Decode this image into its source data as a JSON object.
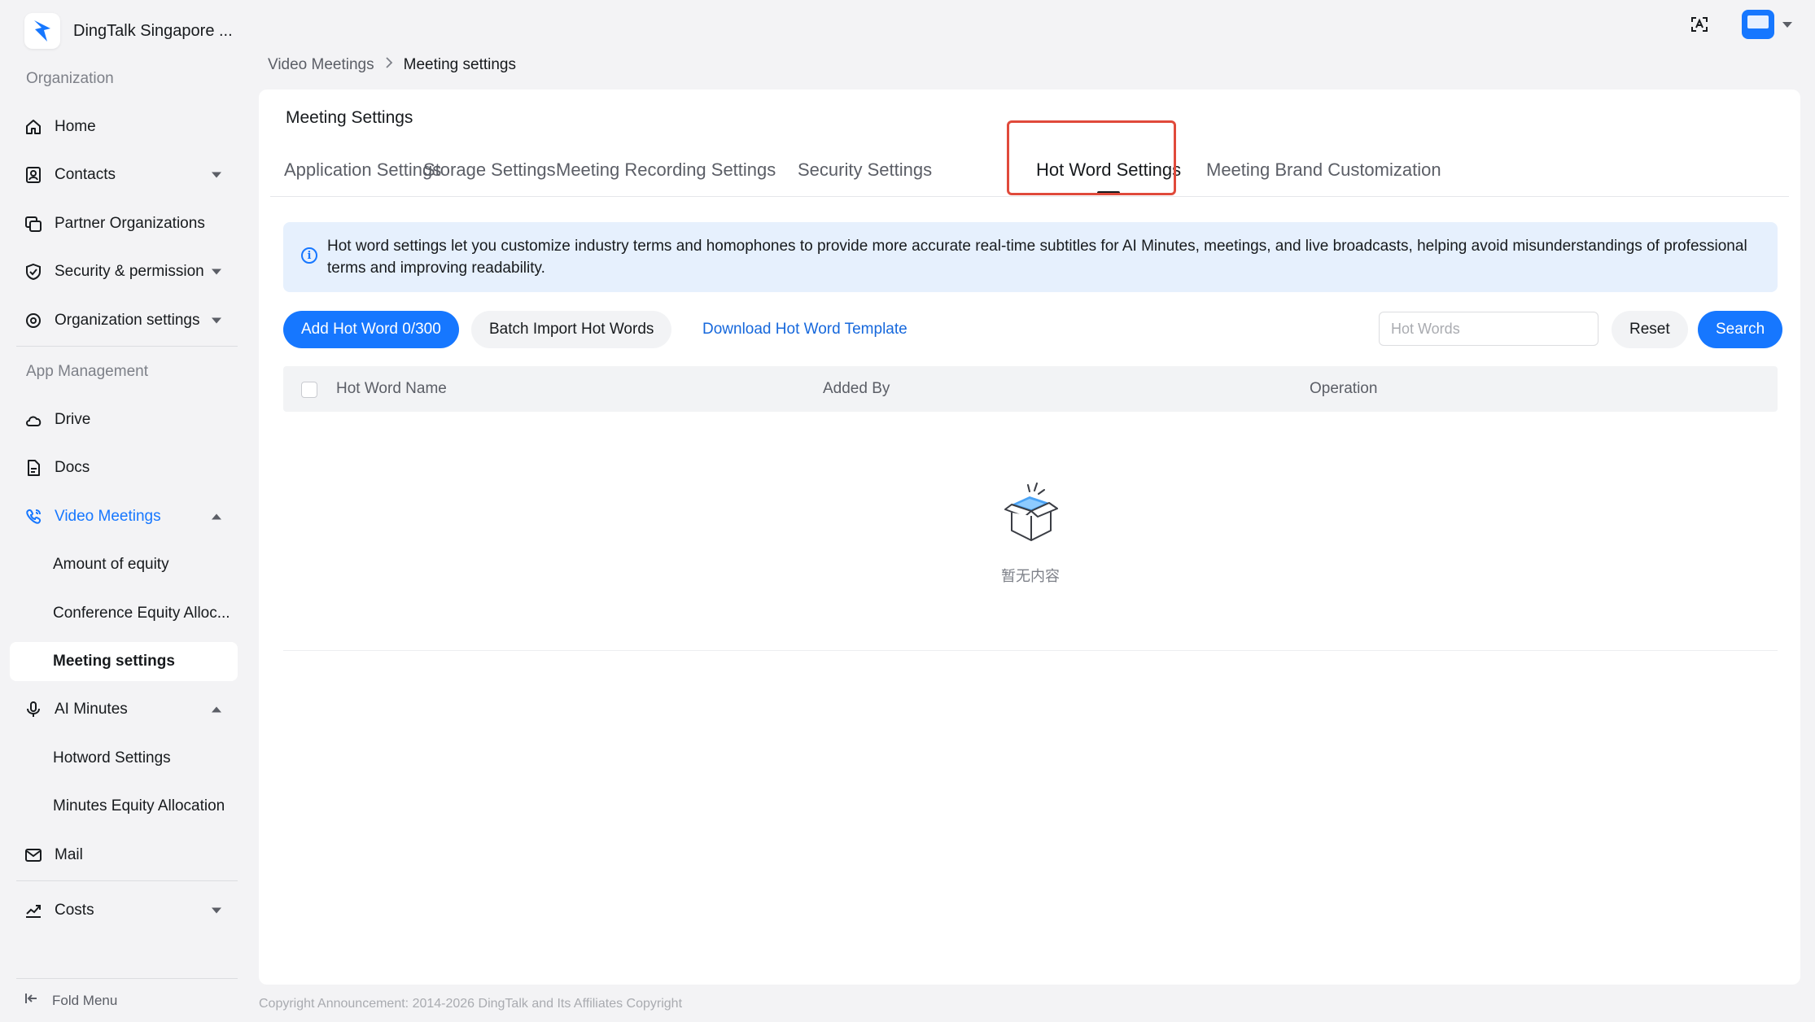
{
  "org": {
    "name": "DingTalk Singapore ..."
  },
  "sidebar": {
    "section_organization": "Organization",
    "section_app_management": "App Management",
    "items": {
      "home": "Home",
      "contacts": "Contacts",
      "partner_orgs": "Partner Organizations",
      "security": "Security & permission",
      "org_settings": "Organization settings",
      "drive": "Drive",
      "docs": "Docs",
      "video_meetings": "Video Meetings",
      "amount_of_equity": "Amount of equity",
      "conference_equity": "Conference Equity Alloc...",
      "meeting_settings": "Meeting settings",
      "ai_minutes": "AI Minutes",
      "hotword_settings": "Hotword Settings",
      "minutes_equity": "Minutes Equity Allocation",
      "mail": "Mail",
      "costs": "Costs"
    },
    "fold_menu": "Fold Menu"
  },
  "breadcrumb": {
    "parent": "Video Meetings",
    "current": "Meeting settings"
  },
  "main": {
    "title": "Meeting Settings",
    "tabs": [
      {
        "label": "Application Settings"
      },
      {
        "label": "Storage Settings"
      },
      {
        "label": "Meeting Recording Settings"
      },
      {
        "label": "Security Settings"
      },
      {
        "label": "Hot Word Settings"
      },
      {
        "label": "Meeting Brand Customization"
      }
    ],
    "active_tab": "Hot Word Settings",
    "info_icon": "i",
    "info_text": "Hot word settings let you customize industry terms and homophones to provide more accurate real-time subtitles for AI Minutes, meetings, and live broadcasts, helping avoid misunderstandings of professional terms and improving readability.",
    "toolbar": {
      "add_button": "Add Hot Word 0/300",
      "batch_import": "Batch Import Hot Words",
      "download_template": "Download Hot Word Template",
      "search_placeholder": "Hot Words",
      "reset": "Reset",
      "search": "Search"
    },
    "table": {
      "columns": [
        "Hot Word Name",
        "Added By",
        "Operation"
      ],
      "rows": [],
      "empty_text": "暂无内容"
    }
  },
  "copyright": "Copyright Announcement: 2014-2026 DingTalk and Its Affiliates Copyright",
  "colors": {
    "primary": "#1677ff",
    "highlight": "#e04a3b",
    "info_bg": "#e6f0fd"
  }
}
